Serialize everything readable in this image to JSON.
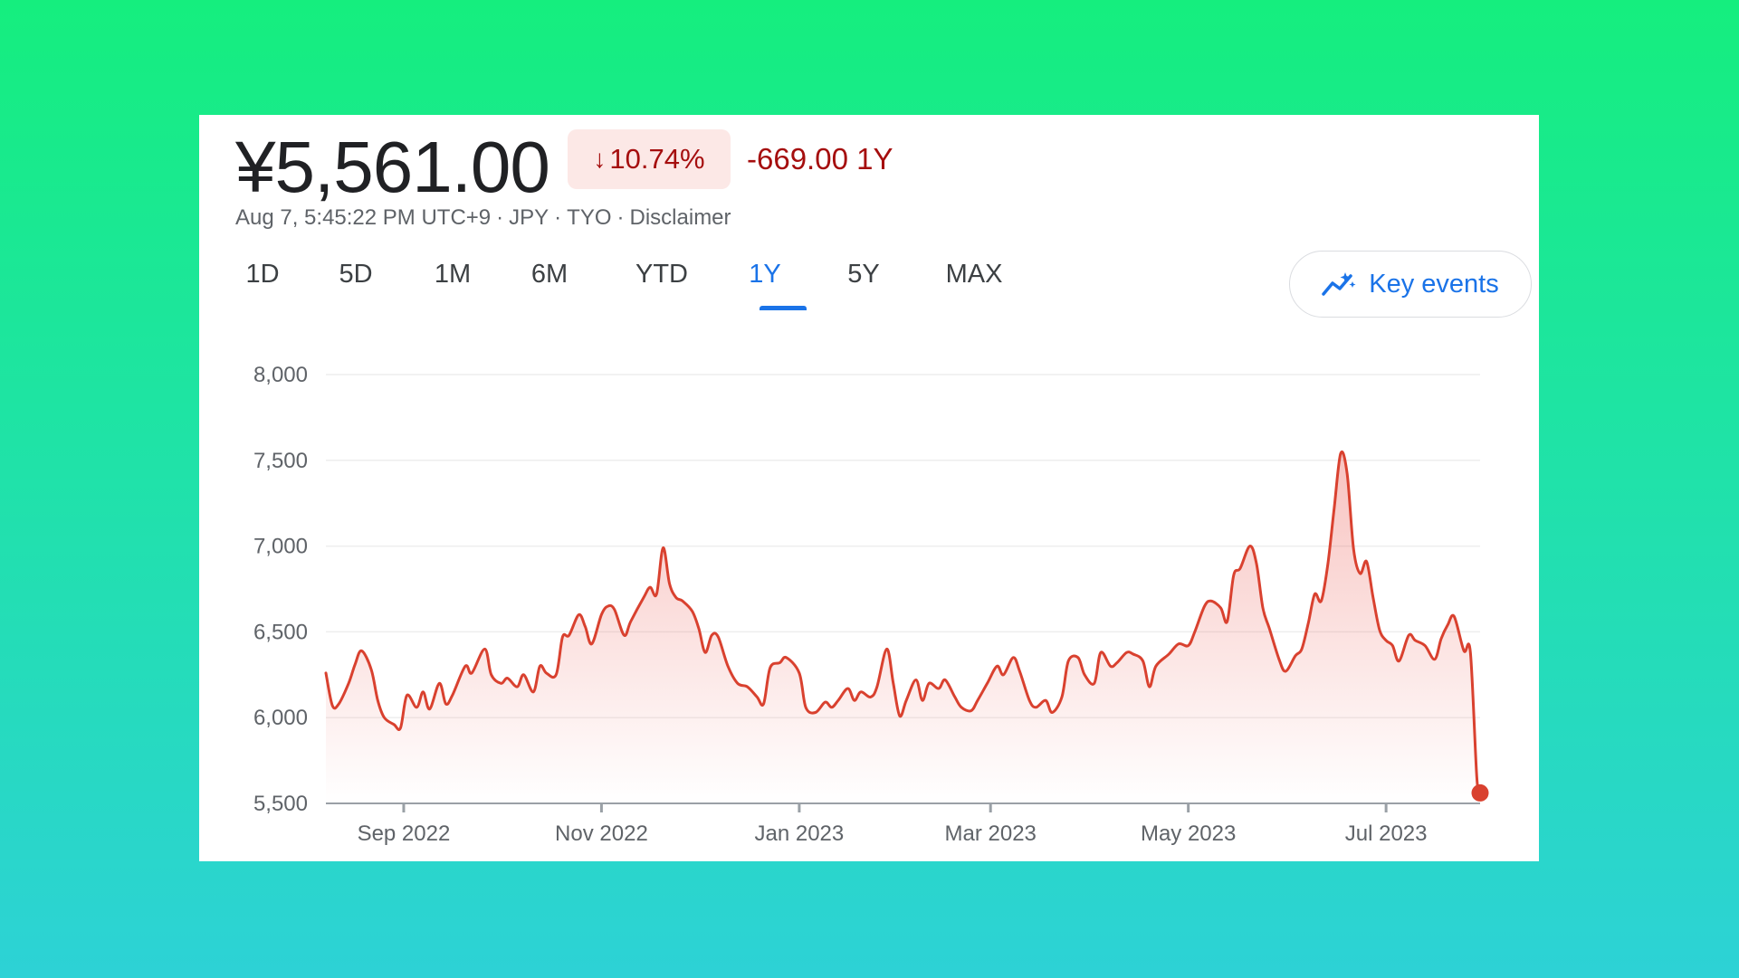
{
  "header": {
    "price": "¥5,561.00",
    "change_percent": "10.74%",
    "change_direction": "down",
    "change_value": "-669.00 1Y",
    "timestamp": "Aug 7, 5:45:22 PM UTC+9",
    "currency": "JPY",
    "exchange": "TYO",
    "disclaimer": "Disclaimer"
  },
  "tabs": [
    {
      "label": "1D"
    },
    {
      "label": "5D"
    },
    {
      "label": "1M"
    },
    {
      "label": "6M"
    },
    {
      "label": "YTD"
    },
    {
      "label": "1Y"
    },
    {
      "label": "5Y"
    },
    {
      "label": "MAX"
    }
  ],
  "active_tab": "1Y",
  "key_events": {
    "label": "Key events",
    "icon": "trending-sparkle-icon"
  },
  "colors": {
    "line": "#d9412f",
    "negative_text": "#a50e0e",
    "negative_bg": "#fce8e6",
    "active_tab": "#1a73e8"
  },
  "chart_data": {
    "type": "area",
    "ylim": [
      5500,
      8000
    ],
    "yticks": [
      "8,000",
      "7,500",
      "7,000",
      "6,500",
      "6,000",
      "5,500"
    ],
    "ytick_values": [
      8000,
      7500,
      7000,
      6500,
      6000,
      5500
    ],
    "xticks": [
      {
        "label": "Sep 2022",
        "date": "2022-09-01"
      },
      {
        "label": "Nov 2022",
        "date": "2022-11-01"
      },
      {
        "label": "Jan 2023",
        "date": "2023-01-01"
      },
      {
        "label": "Mar 2023",
        "date": "2023-03-01"
      },
      {
        "label": "May 2023",
        "date": "2023-05-01"
      },
      {
        "label": "Jul 2023",
        "date": "2023-07-01"
      }
    ],
    "grid": true,
    "series": [
      {
        "points": [
          [
            "2022-08-08",
            6260
          ],
          [
            "2022-08-10",
            6070
          ],
          [
            "2022-08-12",
            6080
          ],
          [
            "2022-08-15",
            6200
          ],
          [
            "2022-08-17",
            6310
          ],
          [
            "2022-08-19",
            6390
          ],
          [
            "2022-08-22",
            6280
          ],
          [
            "2022-08-24",
            6100
          ],
          [
            "2022-08-26",
            6000
          ],
          [
            "2022-08-29",
            5960
          ],
          [
            "2022-08-31",
            5940
          ],
          [
            "2022-09-02",
            6130
          ],
          [
            "2022-09-05",
            6060
          ],
          [
            "2022-09-07",
            6150
          ],
          [
            "2022-09-09",
            6050
          ],
          [
            "2022-09-12",
            6200
          ],
          [
            "2022-09-14",
            6080
          ],
          [
            "2022-09-16",
            6130
          ],
          [
            "2022-09-20",
            6300
          ],
          [
            "2022-09-22",
            6260
          ],
          [
            "2022-09-26",
            6400
          ],
          [
            "2022-09-28",
            6250
          ],
          [
            "2022-10-01",
            6200
          ],
          [
            "2022-10-03",
            6230
          ],
          [
            "2022-10-06",
            6180
          ],
          [
            "2022-10-08",
            6250
          ],
          [
            "2022-10-11",
            6150
          ],
          [
            "2022-10-13",
            6300
          ],
          [
            "2022-10-15",
            6260
          ],
          [
            "2022-10-18",
            6250
          ],
          [
            "2022-10-20",
            6470
          ],
          [
            "2022-10-22",
            6480
          ],
          [
            "2022-10-25",
            6600
          ],
          [
            "2022-10-27",
            6530
          ],
          [
            "2022-10-29",
            6430
          ],
          [
            "2022-11-01",
            6600
          ],
          [
            "2022-11-03",
            6650
          ],
          [
            "2022-11-05",
            6630
          ],
          [
            "2022-11-08",
            6480
          ],
          [
            "2022-11-10",
            6560
          ],
          [
            "2022-11-14",
            6700
          ],
          [
            "2022-11-16",
            6760
          ],
          [
            "2022-11-18",
            6720
          ],
          [
            "2022-11-20",
            6990
          ],
          [
            "2022-11-22",
            6780
          ],
          [
            "2022-11-24",
            6700
          ],
          [
            "2022-11-26",
            6680
          ],
          [
            "2022-11-29",
            6620
          ],
          [
            "2022-12-01",
            6520
          ],
          [
            "2022-12-03",
            6380
          ],
          [
            "2022-12-05",
            6480
          ],
          [
            "2022-12-07",
            6470
          ],
          [
            "2022-12-10",
            6300
          ],
          [
            "2022-12-13",
            6200
          ],
          [
            "2022-12-16",
            6180
          ],
          [
            "2022-12-19",
            6120
          ],
          [
            "2022-12-21",
            6080
          ],
          [
            "2022-12-23",
            6290
          ],
          [
            "2022-12-26",
            6320
          ],
          [
            "2022-12-28",
            6350
          ],
          [
            "2023-01-01",
            6260
          ],
          [
            "2023-01-03",
            6060
          ],
          [
            "2023-01-06",
            6030
          ],
          [
            "2023-01-09",
            6090
          ],
          [
            "2023-01-11",
            6060
          ],
          [
            "2023-01-13",
            6100
          ],
          [
            "2023-01-16",
            6170
          ],
          [
            "2023-01-18",
            6100
          ],
          [
            "2023-01-20",
            6150
          ],
          [
            "2023-01-23",
            6120
          ],
          [
            "2023-01-25",
            6180
          ],
          [
            "2023-01-28",
            6400
          ],
          [
            "2023-01-30",
            6200
          ],
          [
            "2023-02-01",
            6010
          ],
          [
            "2023-02-03",
            6100
          ],
          [
            "2023-02-06",
            6220
          ],
          [
            "2023-02-08",
            6100
          ],
          [
            "2023-02-10",
            6200
          ],
          [
            "2023-02-13",
            6170
          ],
          [
            "2023-02-15",
            6220
          ],
          [
            "2023-02-18",
            6120
          ],
          [
            "2023-02-20",
            6060
          ],
          [
            "2023-02-23",
            6040
          ],
          [
            "2023-02-25",
            6100
          ],
          [
            "2023-02-28",
            6200
          ],
          [
            "2023-03-03",
            6300
          ],
          [
            "2023-03-05",
            6250
          ],
          [
            "2023-03-08",
            6350
          ],
          [
            "2023-03-10",
            6270
          ],
          [
            "2023-03-13",
            6100
          ],
          [
            "2023-03-15",
            6060
          ],
          [
            "2023-03-18",
            6100
          ],
          [
            "2023-03-20",
            6030
          ],
          [
            "2023-03-23",
            6120
          ],
          [
            "2023-03-25",
            6330
          ],
          [
            "2023-03-28",
            6350
          ],
          [
            "2023-03-30",
            6250
          ],
          [
            "2023-04-02",
            6200
          ],
          [
            "2023-04-04",
            6380
          ],
          [
            "2023-04-07",
            6300
          ],
          [
            "2023-04-09",
            6320
          ],
          [
            "2023-04-12",
            6380
          ],
          [
            "2023-04-14",
            6370
          ],
          [
            "2023-04-17",
            6330
          ],
          [
            "2023-04-19",
            6180
          ],
          [
            "2023-04-21",
            6300
          ],
          [
            "2023-04-25",
            6370
          ],
          [
            "2023-04-28",
            6430
          ],
          [
            "2023-05-01",
            6420
          ],
          [
            "2023-05-03",
            6500
          ],
          [
            "2023-05-06",
            6650
          ],
          [
            "2023-05-08",
            6680
          ],
          [
            "2023-05-11",
            6640
          ],
          [
            "2023-05-13",
            6560
          ],
          [
            "2023-05-15",
            6830
          ],
          [
            "2023-05-17",
            6870
          ],
          [
            "2023-05-20",
            7000
          ],
          [
            "2023-05-22",
            6900
          ],
          [
            "2023-05-24",
            6640
          ],
          [
            "2023-05-26",
            6520
          ],
          [
            "2023-05-29",
            6340
          ],
          [
            "2023-05-31",
            6270
          ],
          [
            "2023-06-03",
            6360
          ],
          [
            "2023-06-05",
            6400
          ],
          [
            "2023-06-07",
            6550
          ],
          [
            "2023-06-09",
            6720
          ],
          [
            "2023-06-11",
            6680
          ],
          [
            "2023-06-13",
            6890
          ],
          [
            "2023-06-15",
            7220
          ],
          [
            "2023-06-17",
            7540
          ],
          [
            "2023-06-19",
            7420
          ],
          [
            "2023-06-21",
            6980
          ],
          [
            "2023-06-23",
            6840
          ],
          [
            "2023-06-25",
            6910
          ],
          [
            "2023-06-27",
            6700
          ],
          [
            "2023-06-29",
            6510
          ],
          [
            "2023-07-01",
            6450
          ],
          [
            "2023-07-03",
            6420
          ],
          [
            "2023-07-05",
            6330
          ],
          [
            "2023-07-08",
            6480
          ],
          [
            "2023-07-10",
            6450
          ],
          [
            "2023-07-13",
            6420
          ],
          [
            "2023-07-16",
            6340
          ],
          [
            "2023-07-18",
            6460
          ],
          [
            "2023-07-20",
            6540
          ],
          [
            "2023-07-22",
            6590
          ],
          [
            "2023-07-25",
            6390
          ],
          [
            "2023-07-27",
            6380
          ],
          [
            "2023-07-29",
            5650
          ],
          [
            "2023-07-30",
            5561
          ]
        ]
      }
    ]
  }
}
